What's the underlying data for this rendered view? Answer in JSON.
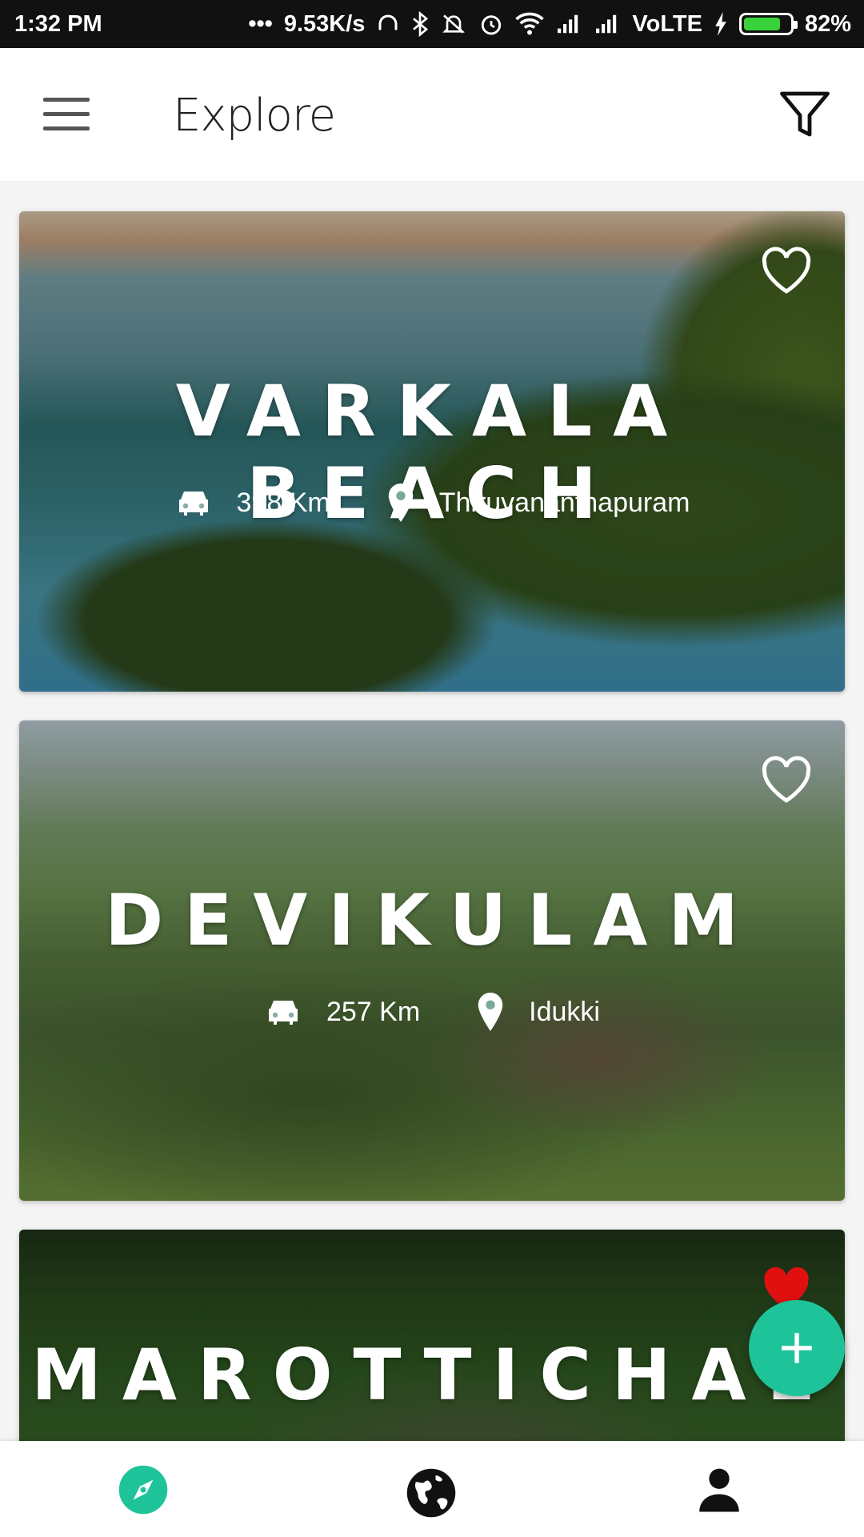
{
  "status_bar": {
    "time": "1:32 PM",
    "speed": "9.53K/s",
    "network": "VoLTE",
    "battery": "82%",
    "battery_level": 0.82,
    "battery_color": "#3ad23a"
  },
  "app_bar": {
    "title": "Explore",
    "menu_icon": "hamburger-menu-icon",
    "filter_icon": "filter-icon"
  },
  "places": [
    {
      "name": "VARKALA BEACH",
      "distance": "398 Km",
      "location": "Thiruvananthapuram",
      "favorite": false
    },
    {
      "name": "DEVIKULAM",
      "distance": "257 Km",
      "location": "Idukki",
      "favorite": true
    },
    {
      "name": "MAROTTICHAL",
      "favorite": true
    }
  ],
  "fab": {
    "icon": "plus-icon",
    "color": "#1ec39a"
  },
  "bottom_nav": {
    "items": [
      {
        "icon": "compass-icon",
        "active": true
      },
      {
        "icon": "globe-icon",
        "active": false
      },
      {
        "icon": "person-icon",
        "active": false
      }
    ],
    "active_color": "#1ec39a"
  },
  "colors": {
    "favorite_red": "#e01010"
  }
}
